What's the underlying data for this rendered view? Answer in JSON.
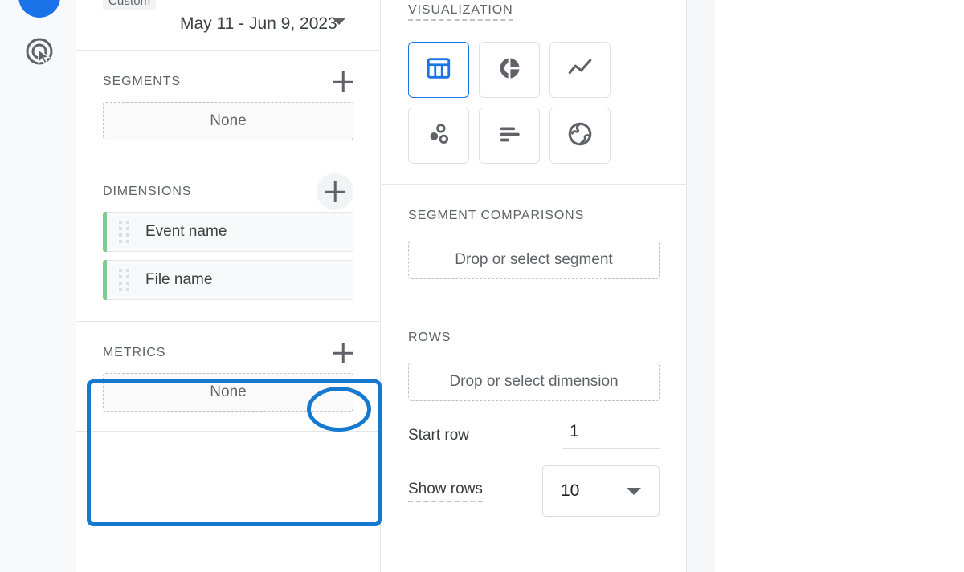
{
  "rail": {
    "items": [
      {
        "name": "logo-circle",
        "icon": "blue-circle"
      },
      {
        "name": "exploration-target-icon",
        "icon": "target-cursor-icon"
      }
    ]
  },
  "left_panel": {
    "date_range": {
      "chip_label": "Custom",
      "value": "May 11 - Jun 9, 2023",
      "caret_icon": "chevron-down-icon"
    },
    "segments": {
      "title": "SEGMENTS",
      "add_icon": "plus-icon",
      "placeholder": "None"
    },
    "dimensions": {
      "title": "DIMENSIONS",
      "add_icon": "plus-icon",
      "items": [
        {
          "label": "Event name",
          "handle_icon": "drag-handle-icon"
        },
        {
          "label": "File name",
          "handle_icon": "drag-handle-icon"
        }
      ]
    },
    "metrics": {
      "title": "METRICS",
      "add_icon": "plus-icon",
      "placeholder": "None"
    }
  },
  "right_panel": {
    "visualization": {
      "title": "VISUALIZATION",
      "options": [
        {
          "name": "table-chart",
          "icon": "table-icon",
          "selected": true
        },
        {
          "name": "donut-chart",
          "icon": "donut-chart-icon",
          "selected": false
        },
        {
          "name": "line-chart",
          "icon": "line-chart-icon",
          "selected": false
        },
        {
          "name": "scatter-chart",
          "icon": "scatter-plot-icon",
          "selected": false
        },
        {
          "name": "bar-chart",
          "icon": "bar-chart-icon",
          "selected": false
        },
        {
          "name": "geo-map",
          "icon": "globe-icon",
          "selected": false
        }
      ]
    },
    "segment_comparisons": {
      "title": "SEGMENT COMPARISONS",
      "placeholder": "Drop or select segment"
    },
    "rows": {
      "title": "ROWS",
      "placeholder": "Drop or select dimension",
      "start_row_label": "Start row",
      "start_row_value": "1",
      "show_rows_label": "Show rows",
      "show_rows_value": "10",
      "show_rows_caret": "chevron-down-icon"
    }
  },
  "annotations": {
    "color": "#1579d1",
    "highlight_rect_target": "metrics-section",
    "highlight_ellipse_target": "metrics-add-button"
  }
}
